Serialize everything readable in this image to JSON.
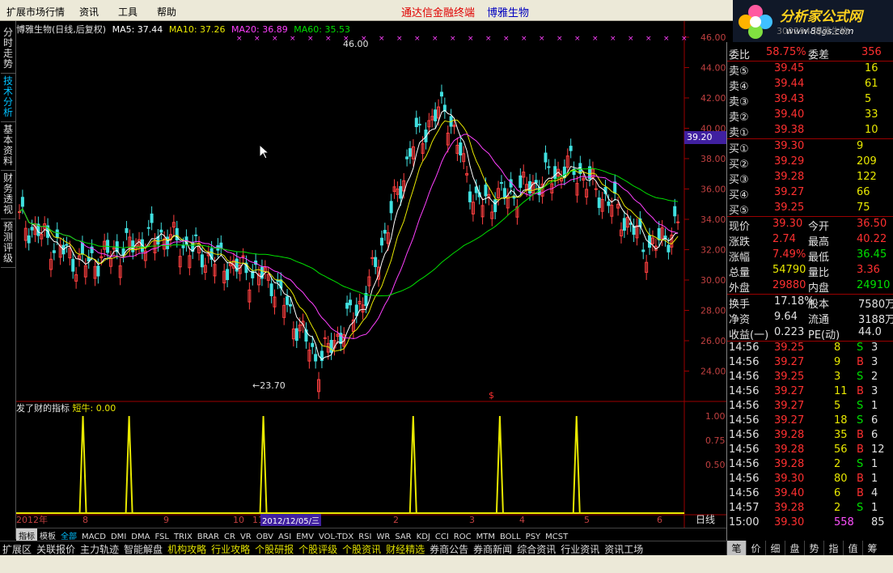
{
  "menu": {
    "items": [
      "扩展市场行情",
      "资讯",
      "工具",
      "帮助"
    ],
    "center_title": "通达信金融终端",
    "stock_name": "博雅生物"
  },
  "logo": {
    "name": "分析家公式网",
    "url": "www.88gs.com"
  },
  "stock_code_overlay": "300294 博雅生物",
  "sidetabs": [
    "分时走势",
    "技术分析",
    "基本资料",
    "财务透视",
    "预测评级"
  ],
  "chart_header": {
    "title": "博雅生物(日线,后复权)",
    "ma": [
      {
        "label": "MA5: 37.44",
        "color": "#ffffff"
      },
      {
        "label": "MA10: 37.26",
        "color": "#e8e800"
      },
      {
        "label": "MA20: 36.89",
        "color": "#ff40ff"
      },
      {
        "label": "MA60: 35.53",
        "color": "#00e000"
      }
    ]
  },
  "indicator_header": {
    "name": "发了财的指标",
    "label": "短牛: 0.00"
  },
  "price_tag": "39.20",
  "date_box": "2012/12/05/三",
  "period_label": "日线",
  "chart_data": {
    "type": "candlestick",
    "yaxis": {
      "min": 22,
      "max": 46,
      "ticks": [
        "46.00",
        "44.00",
        "42.00",
        "40.00",
        "38.00",
        "36.00",
        "34.00",
        "32.00",
        "30.00",
        "28.00",
        "26.00",
        "24.00"
      ]
    },
    "annotations": {
      "high": "46.00",
      "low": "←23.70",
      "dollar": "$"
    },
    "x_labels": [
      "2012年",
      "8",
      "9",
      "10",
      "11",
      "2",
      "3",
      "4",
      "5",
      "6"
    ],
    "indicator_ticks": [
      "1.00",
      "0.75",
      "0.50"
    ],
    "indicator_spikes": [
      0.094,
      0.159,
      0.348,
      0.559,
      0.681,
      0.789
    ],
    "scale_buttons": [
      "+",
      "-",
      "0"
    ]
  },
  "tabbar": [
    "指标",
    "模板",
    "全部",
    "MACD",
    "DMI",
    "DMA",
    "FSL",
    "TRIX",
    "BRAR",
    "CR",
    "VR",
    "OBV",
    "ASI",
    "EMV",
    "VOL-TDX",
    "RSI",
    "WR",
    "SAR",
    "KDJ",
    "CCI",
    "ROC",
    "MTM",
    "BOLL",
    "PSY",
    "MCST"
  ],
  "bottombar": [
    "扩展区",
    "关联报价",
    "主力轨迹",
    "智能解盘",
    "机构攻略",
    "行业攻略",
    "个股研报",
    "个股评级",
    "个股资讯",
    "财经精选",
    "券商公告",
    "券商新闻",
    "综合资讯",
    "行业资讯",
    "资讯工场"
  ],
  "right_tabs": [
    "笔",
    "价",
    "细",
    "盘",
    "势",
    "指",
    "值",
    "筹"
  ],
  "quote": {
    "wb": {
      "label": "委比",
      "value": "58.75%",
      "diff_label": "委差",
      "diff": "356"
    },
    "sells": [
      [
        "卖⑤",
        "39.45",
        "16"
      ],
      [
        "卖④",
        "39.44",
        "61"
      ],
      [
        "卖③",
        "39.43",
        "5"
      ],
      [
        "卖②",
        "39.40",
        "33"
      ],
      [
        "卖①",
        "39.38",
        "10"
      ]
    ],
    "buys": [
      [
        "买①",
        "39.30",
        "9"
      ],
      [
        "买②",
        "39.29",
        "209"
      ],
      [
        "买③",
        "39.28",
        "122"
      ],
      [
        "买④",
        "39.27",
        "66"
      ],
      [
        "买⑤",
        "39.25",
        "75"
      ]
    ],
    "stats": [
      [
        "现价",
        "39.30",
        "今开",
        "36.50"
      ],
      [
        "涨跌",
        "2.74",
        "最高",
        "40.22"
      ],
      [
        "涨幅",
        "7.49%",
        "最低",
        "36.45"
      ],
      [
        "总量",
        "54790",
        "量比",
        "3.36"
      ],
      [
        "外盘",
        "29880",
        "内盘",
        "24910"
      ]
    ],
    "stats2": [
      [
        "换手",
        "17.18%",
        "股本",
        "7580万"
      ],
      [
        "净资",
        "9.64",
        "流通",
        "3188万"
      ],
      [
        "收益(一)",
        "0.223",
        "PE(动)",
        "44.0"
      ]
    ],
    "ticks": [
      [
        "14:56",
        "39.25",
        "8",
        "S",
        "3"
      ],
      [
        "14:56",
        "39.27",
        "9",
        "B",
        "3"
      ],
      [
        "14:56",
        "39.25",
        "3",
        "S",
        "2"
      ],
      [
        "14:56",
        "39.27",
        "11",
        "B",
        "3"
      ],
      [
        "14:56",
        "39.27",
        "5",
        "S",
        "1"
      ],
      [
        "14:56",
        "39.27",
        "18",
        "S",
        "6"
      ],
      [
        "14:56",
        "39.28",
        "35",
        "B",
        "6"
      ],
      [
        "14:56",
        "39.28",
        "56",
        "B",
        "12"
      ],
      [
        "14:56",
        "39.28",
        "2",
        "S",
        "1"
      ],
      [
        "14:56",
        "39.30",
        "80",
        "B",
        "1"
      ],
      [
        "14:56",
        "39.40",
        "6",
        "B",
        "4"
      ],
      [
        "14:57",
        "39.28",
        "2",
        "S",
        "1"
      ],
      [
        "15:00",
        "39.30",
        "558",
        "",
        "85"
      ]
    ]
  }
}
